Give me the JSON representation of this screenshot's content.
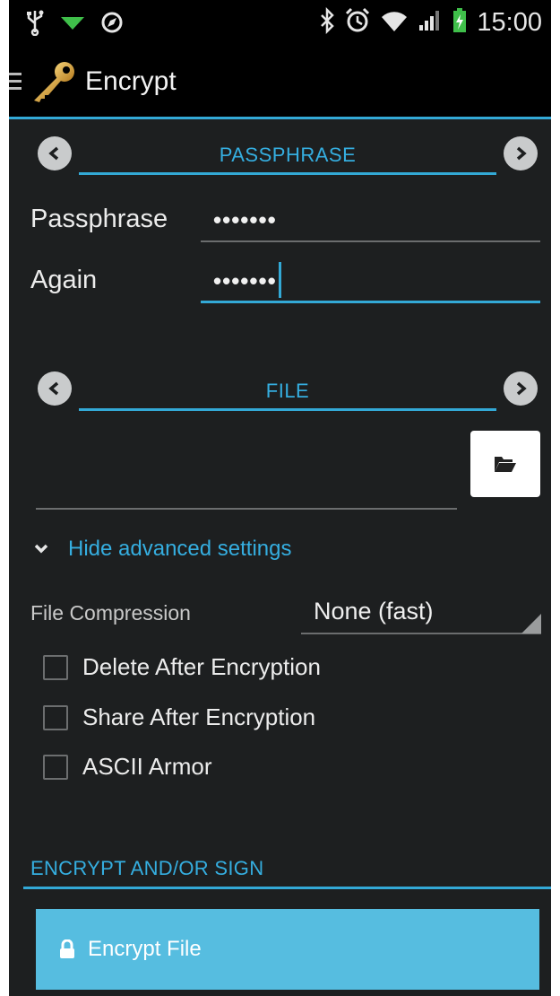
{
  "status_bar": {
    "time": "15:00",
    "icons": [
      "usb-icon",
      "download-icon",
      "compass-icon",
      "bluetooth-icon",
      "alarm-icon",
      "wifi-icon",
      "signal-icon",
      "battery-charging-icon"
    ]
  },
  "action_bar": {
    "title": "Encrypt",
    "icons": [
      "drawer-menu-icon",
      "key-icon"
    ]
  },
  "passphrase_section": {
    "title": "PASSPHRASE",
    "passphrase_label": "Passphrase",
    "passphrase_value": "•••••••",
    "again_label": "Again",
    "again_value": "•••••••"
  },
  "file_section": {
    "title": "FILE",
    "file_path": ""
  },
  "advanced": {
    "toggle_label": "Hide advanced settings",
    "compression_label": "File Compression",
    "compression_value": "None (fast)",
    "checkboxes": [
      {
        "label": "Delete After Encryption",
        "checked": false
      },
      {
        "label": "Share After Encryption",
        "checked": false
      },
      {
        "label": "ASCII Armor",
        "checked": false
      }
    ]
  },
  "sign_section": {
    "title": "ENCRYPT AND/OR SIGN",
    "button_label": "Encrypt File"
  },
  "colors": {
    "accent": "#33a9d6",
    "background": "#1d1f20",
    "button": "#56bde0"
  }
}
